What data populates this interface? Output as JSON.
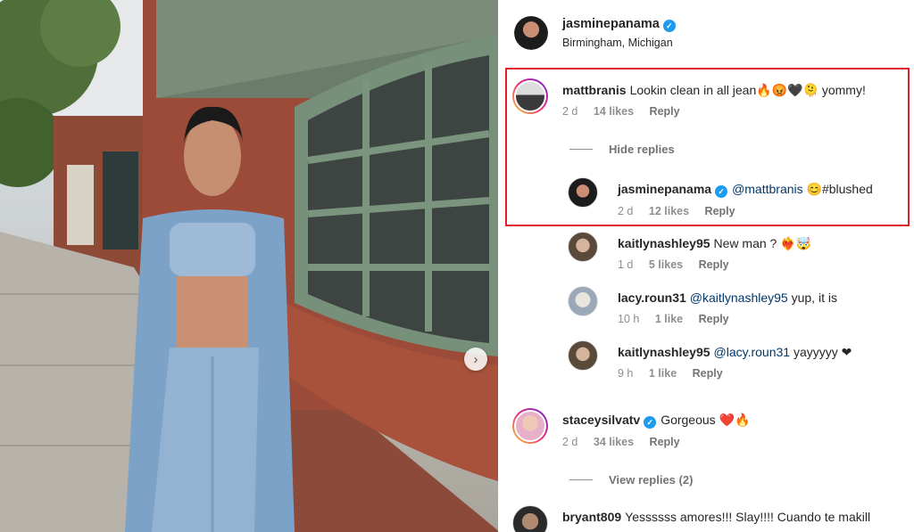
{
  "post": {
    "author": "jasminepanama",
    "location": "Birmingham, Michigan",
    "carousel_next_icon": "chevron-right-icon"
  },
  "comments": [
    {
      "user": "mattbranis",
      "text": "Lookin clean in all jean🔥😡🖤🫠 yommy!",
      "time": "2 d",
      "likes": "14 likes",
      "reply": "Reply",
      "toggle": "Hide replies",
      "replies": [
        {
          "user": "jasminepanama",
          "mention": "@mattbranis",
          "text": " 😊#blushed",
          "time": "2 d",
          "likes": "12 likes",
          "reply": "Reply"
        },
        {
          "user": "kaitlynashley95",
          "text": "New man ? ❤️‍🔥🤯",
          "time": "1 d",
          "likes": "5 likes",
          "reply": "Reply"
        },
        {
          "user": "lacy.roun31",
          "mention": "@kaitlynashley95",
          "text": " yup, it is",
          "time": "10 h",
          "likes": "1 like",
          "reply": "Reply"
        },
        {
          "user": "kaitlynashley95",
          "mention": "@lacy.roun31",
          "text": " yayyyyy ❤",
          "time": "9 h",
          "likes": "1 like",
          "reply": "Reply"
        }
      ]
    },
    {
      "user": "staceysilvatv",
      "text": "Gorgeous ❤️🔥",
      "time": "2 d",
      "likes": "34 likes",
      "reply": "Reply",
      "toggle": "View replies (2)"
    },
    {
      "user": "bryant809",
      "text": "Yessssss amores!!! Slay!!!! Cuando te makill"
    }
  ],
  "colors": {
    "verified": "#1d9bf0",
    "highlight": "#e0202a",
    "mention": "#00376b"
  }
}
